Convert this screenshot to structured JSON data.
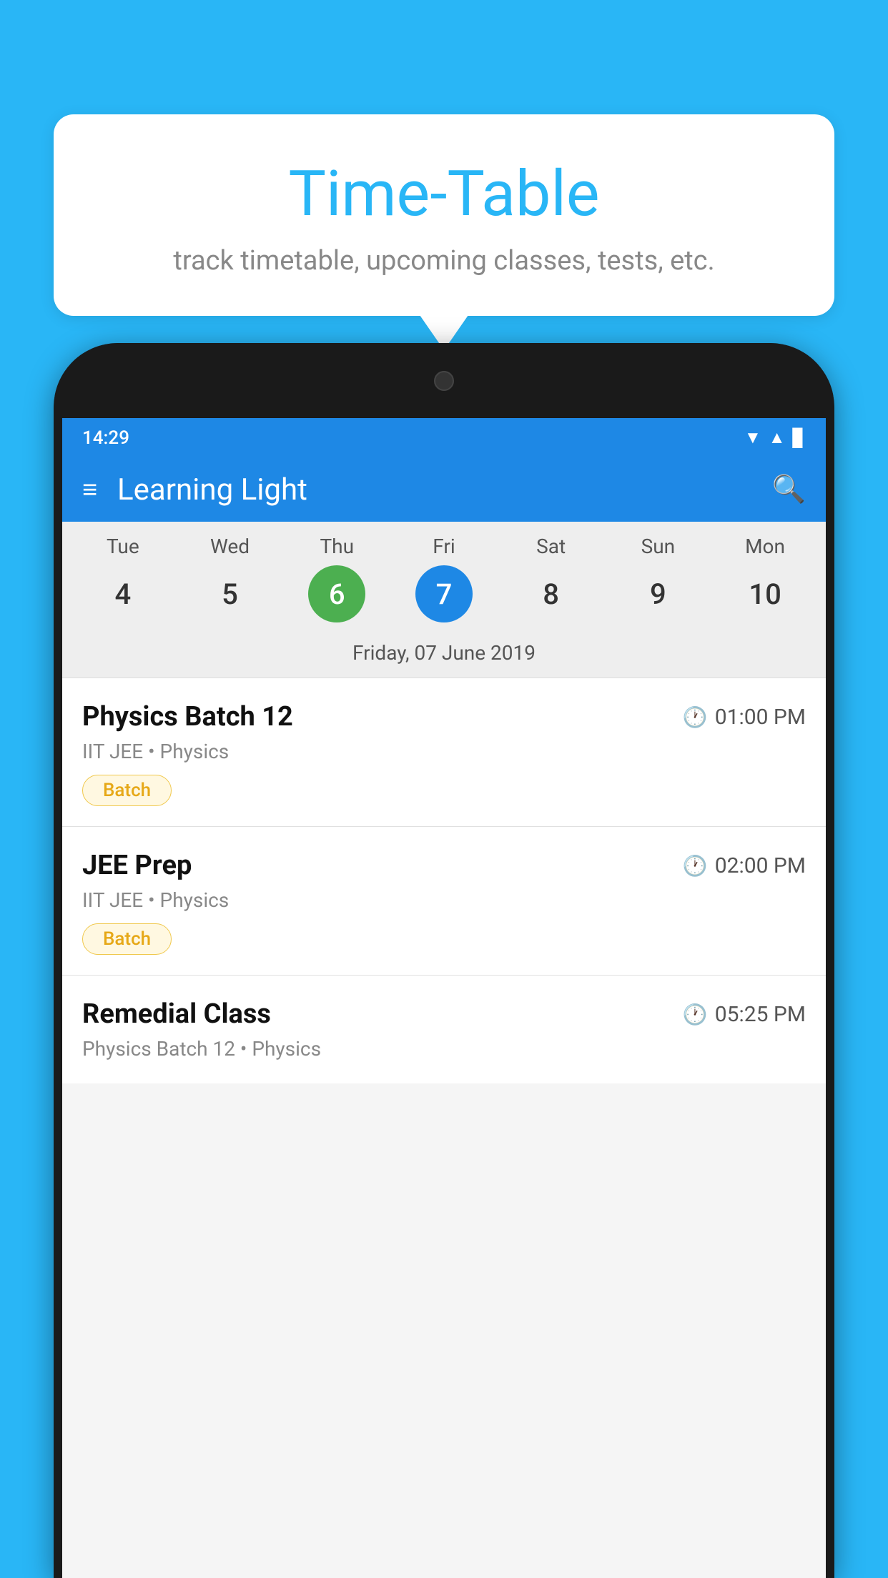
{
  "background_color": "#29B6F6",
  "bubble": {
    "title": "Time-Table",
    "subtitle": "track timetable, upcoming classes, tests, etc."
  },
  "phone": {
    "status_bar": {
      "time": "14:29"
    },
    "app_bar": {
      "title": "Learning Light"
    },
    "calendar": {
      "days": [
        {
          "label": "Tue",
          "num": "4",
          "state": "normal"
        },
        {
          "label": "Wed",
          "num": "5",
          "state": "normal"
        },
        {
          "label": "Thu",
          "num": "6",
          "state": "today"
        },
        {
          "label": "Fri",
          "num": "7",
          "state": "selected"
        },
        {
          "label": "Sat",
          "num": "8",
          "state": "normal"
        },
        {
          "label": "Sun",
          "num": "9",
          "state": "normal"
        },
        {
          "label": "Mon",
          "num": "10",
          "state": "normal"
        }
      ],
      "selected_date_label": "Friday, 07 June 2019"
    },
    "classes": [
      {
        "name": "Physics Batch 12",
        "time": "01:00 PM",
        "meta": "IIT JEE • Physics",
        "tag": "Batch"
      },
      {
        "name": "JEE Prep",
        "time": "02:00 PM",
        "meta": "IIT JEE • Physics",
        "tag": "Batch"
      },
      {
        "name": "Remedial Class",
        "time": "05:25 PM",
        "meta": "Physics Batch 12 • Physics",
        "tag": null
      }
    ]
  },
  "icons": {
    "hamburger": "≡",
    "search": "🔍",
    "clock": "🕐"
  }
}
